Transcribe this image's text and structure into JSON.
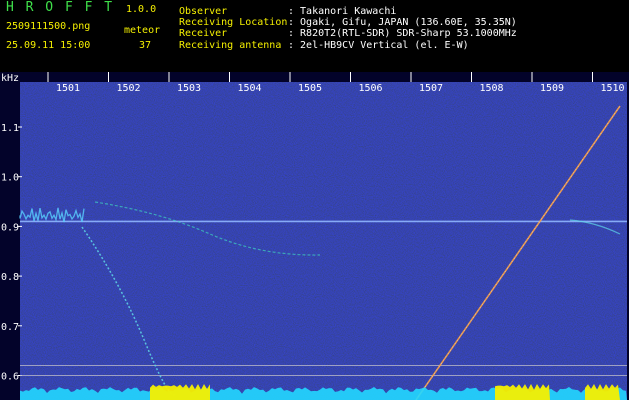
{
  "header": {
    "app_name": "H R O F F T",
    "version": "1.0.0",
    "filename": "2509111500.png",
    "datetime": "25.09.11 15:00",
    "meteor_label": "meteor",
    "meteor_count": "37",
    "info_labels": [
      "Observer",
      "Receiving Location",
      "Receiver",
      "Receiving antenna"
    ],
    "info_values": [
      ": Takanori Kawachi",
      ": Ogaki, Gifu, JAPAN (136.60E, 35.35N)",
      ": R820T2(RTL-SDR) SDR-Sharp 53.1000MHz",
      ": 2el-HB9CV Vertical (el. E-W)"
    ]
  },
  "colors": {
    "label_green": "#3fe04a",
    "label_yellow": "#f5f000",
    "text_white": "#ffffff",
    "background": "#000000"
  },
  "chart_data": {
    "type": "heatmap",
    "ylabel": "kHz",
    "y_ticks": [
      "1.1",
      "1.0",
      "0.9",
      "0.8",
      "0.7",
      "0.6"
    ],
    "x_ticks": [
      "1501",
      "1502",
      "1503",
      "1504",
      "1505",
      "1506",
      "1507",
      "1508",
      "1509",
      "1510"
    ],
    "carrier_khz": 0.91,
    "reference_lines_khz": [
      0.62,
      0.6
    ]
  }
}
